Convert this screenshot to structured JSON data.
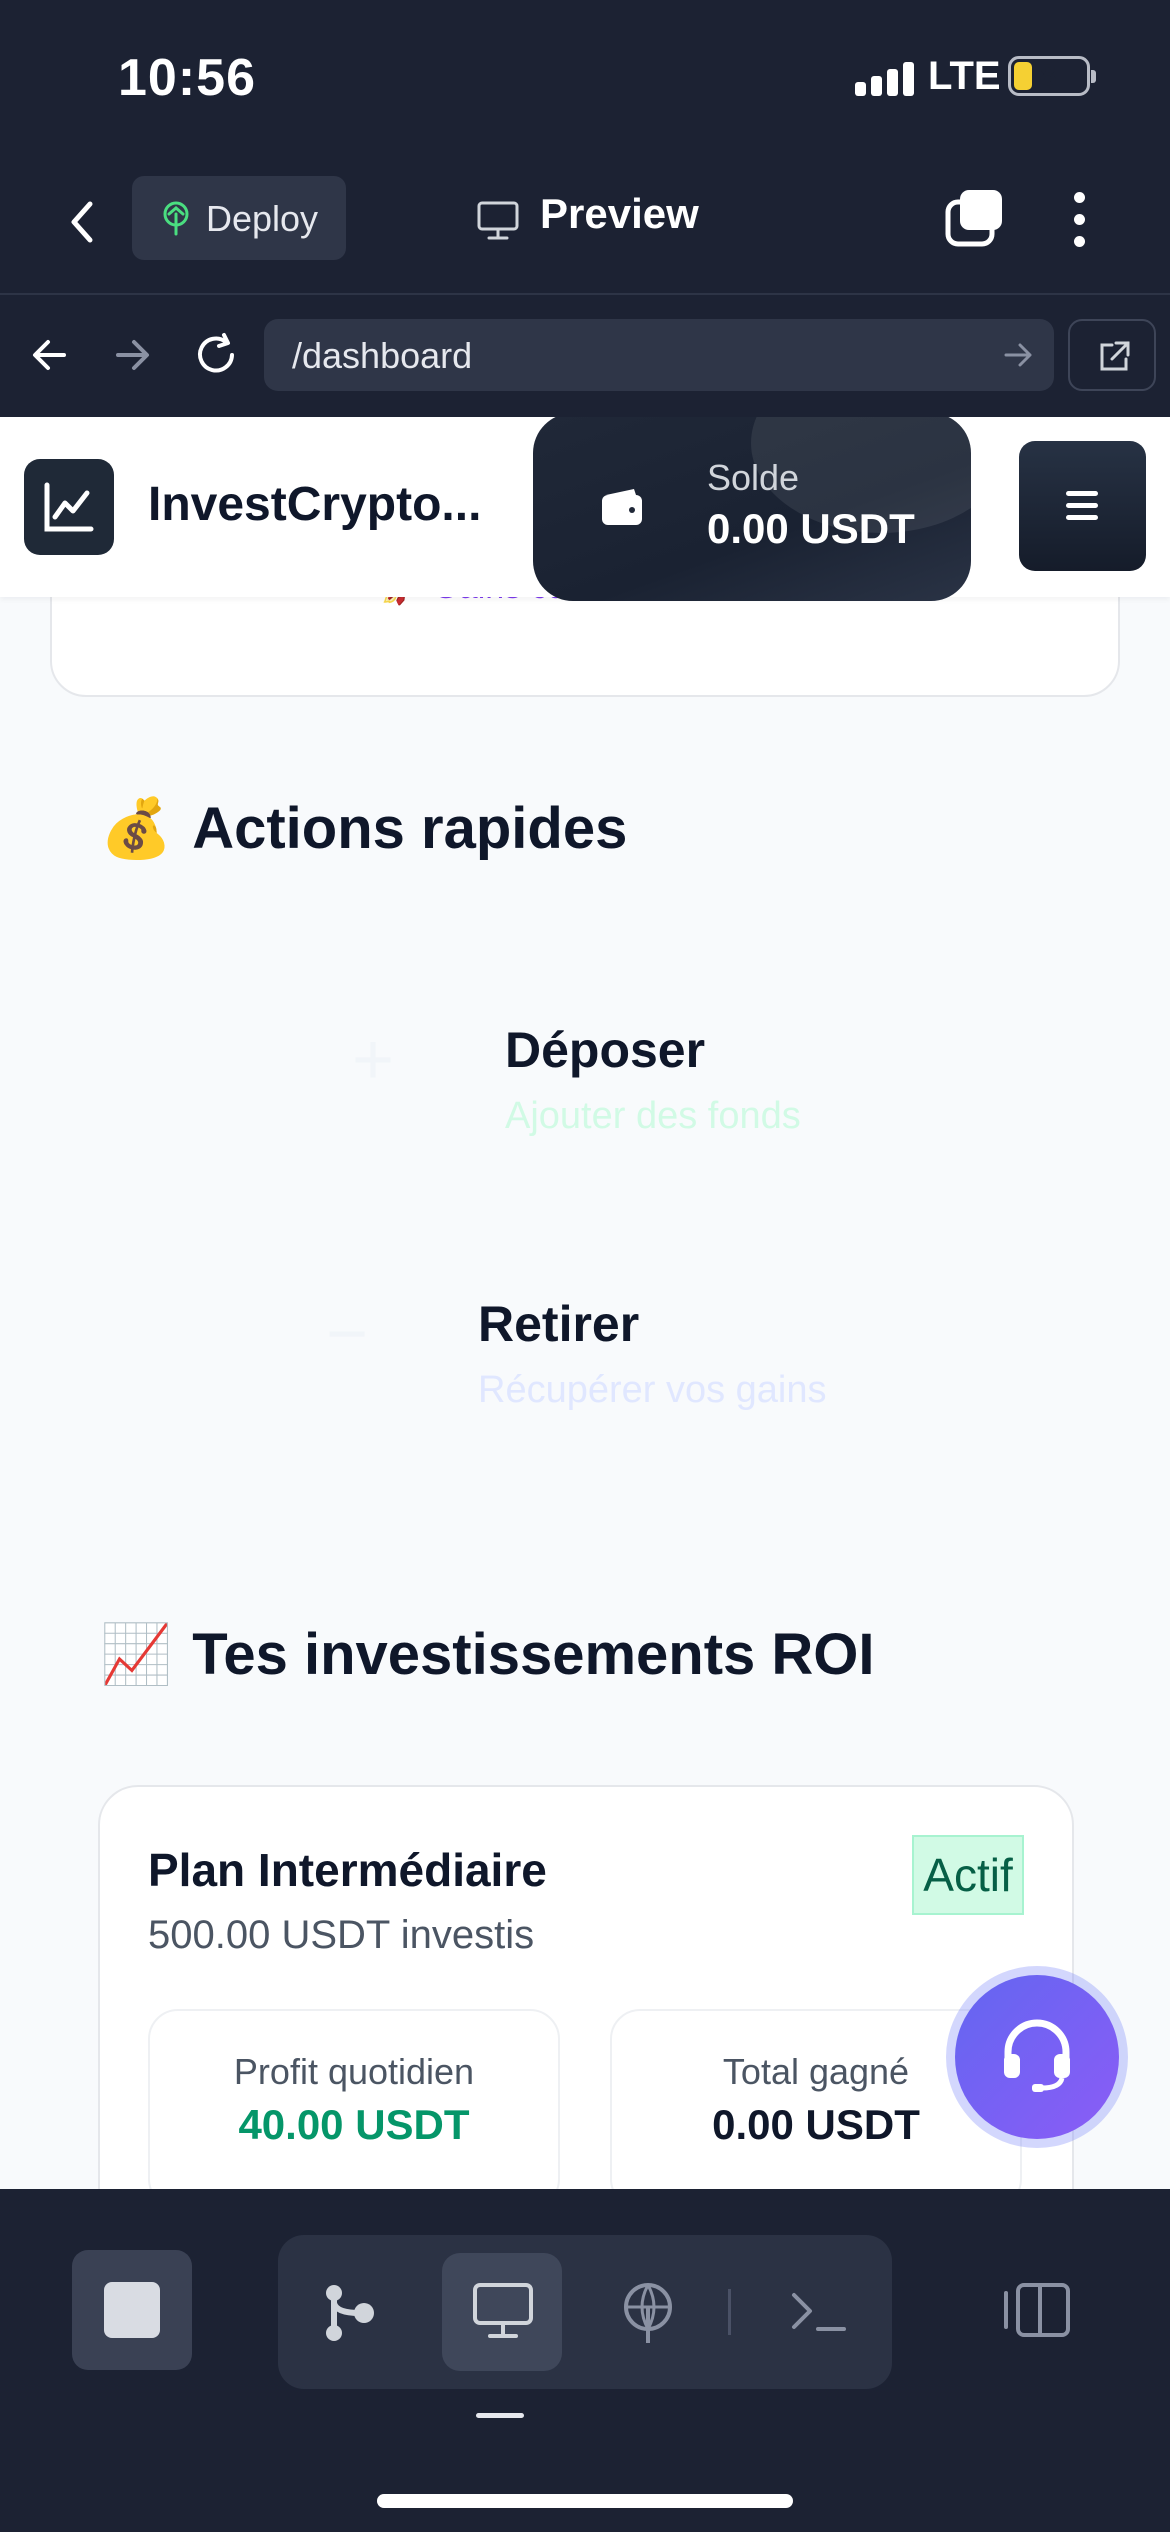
{
  "status_bar": {
    "time": "10:56",
    "network": "LTE",
    "battery": "8"
  },
  "app_toolbar": {
    "deploy_label": "Deploy",
    "preview_label": "Preview"
  },
  "url_bar": {
    "url": "/dashboard"
  },
  "site": {
    "brand": "InvestCrypto...",
    "balance_label": "Solde",
    "balance_value": "0.00 USDT"
  },
  "gains": {
    "emoji": "🚀",
    "label": "Gains cumulés"
  },
  "quick_actions": {
    "emoji": "💰",
    "title": "Actions rapides",
    "deposit": {
      "symbol": "+",
      "title": "Déposer",
      "subtitle": "Ajouter des fonds",
      "subtitle_color": "#d1fae5"
    },
    "withdraw": {
      "symbol": "−",
      "title": "Retirer",
      "subtitle": "Récupérer vos gains",
      "subtitle_color": "#e0e7ff"
    }
  },
  "investments": {
    "emoji": "📈",
    "title": "Tes investissements ROI",
    "plan": {
      "name": "Plan Intermédiaire",
      "amount": "500.00 USDT investis",
      "status": "Actif",
      "daily_profit_label": "Profit quotidien",
      "daily_profit_value": "40.00 USDT",
      "total_label": "Total gagné",
      "total_value": "0.00 USDT"
    }
  },
  "colors": {
    "accent_green": "#059669",
    "accent_purple": "#7c3aed",
    "dark": "#1c2233"
  },
  "icons": [
    "back-chevron-icon",
    "deploy-icon",
    "monitor-icon",
    "tabs-icon",
    "more-icon",
    "arrow-left-icon",
    "arrow-right-icon",
    "reload-icon",
    "external-link-icon",
    "chart-logo-icon",
    "wallet-icon",
    "hamburger-icon",
    "headset-icon",
    "stop-icon",
    "branch-icon",
    "terminal-icon",
    "panel-icon"
  ]
}
